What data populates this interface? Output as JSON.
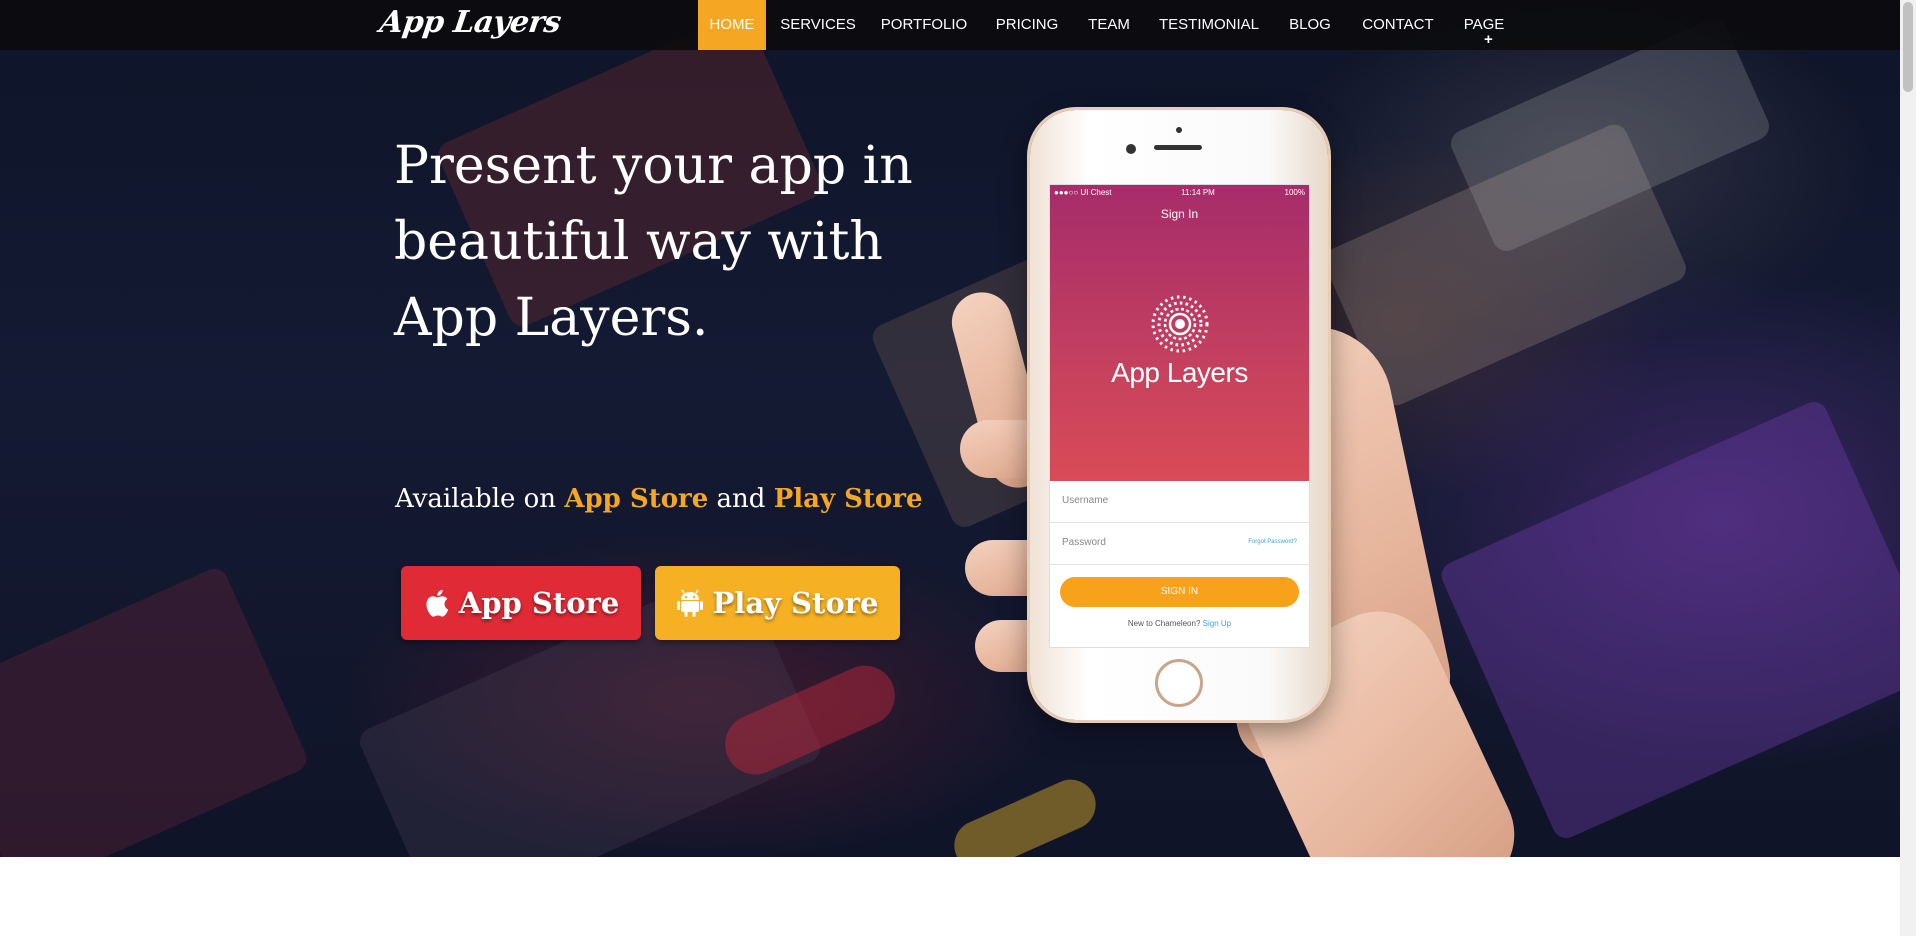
{
  "nav": {
    "logo": "App Layers",
    "items": [
      {
        "label": "HOME",
        "active": true
      },
      {
        "label": "SERVICES"
      },
      {
        "label": "PORTFOLIO"
      },
      {
        "label": "PRICING"
      },
      {
        "label": "TEAM"
      },
      {
        "label": "TESTIMONIAL"
      },
      {
        "label": "BLOG"
      },
      {
        "label": "CONTACT"
      },
      {
        "label": "PAGE"
      }
    ],
    "page_plus": "+"
  },
  "hero": {
    "headline": "Present your app in beautiful way with App Layers.",
    "available": {
      "prefix": "Available on ",
      "store1": "App Store",
      "middle": " and ",
      "store2": "Play Store"
    },
    "buttons": {
      "app_store": {
        "label": "App Store",
        "icon": "apple-icon"
      },
      "play_store": {
        "label": "Play Store",
        "icon": "android-icon"
      }
    }
  },
  "phone_screen": {
    "status_left": "●●●○○ UI Chest",
    "status_time": "11:14 PM",
    "status_right": "100%",
    "title": "Sign In",
    "app_name": "App Layers",
    "username_placeholder": "Username",
    "password_placeholder": "Password",
    "forgot_password": "Forgot Password?",
    "signin_button": "SIGN IN",
    "signup_prefix": "New to Chameleon? ",
    "signup_link": "Sign Up"
  },
  "colors": {
    "accent": "#f5a623",
    "app_store_button": "#e02a36",
    "play_store_button": "#f5b023",
    "nav_background": "#0c0c0e"
  }
}
